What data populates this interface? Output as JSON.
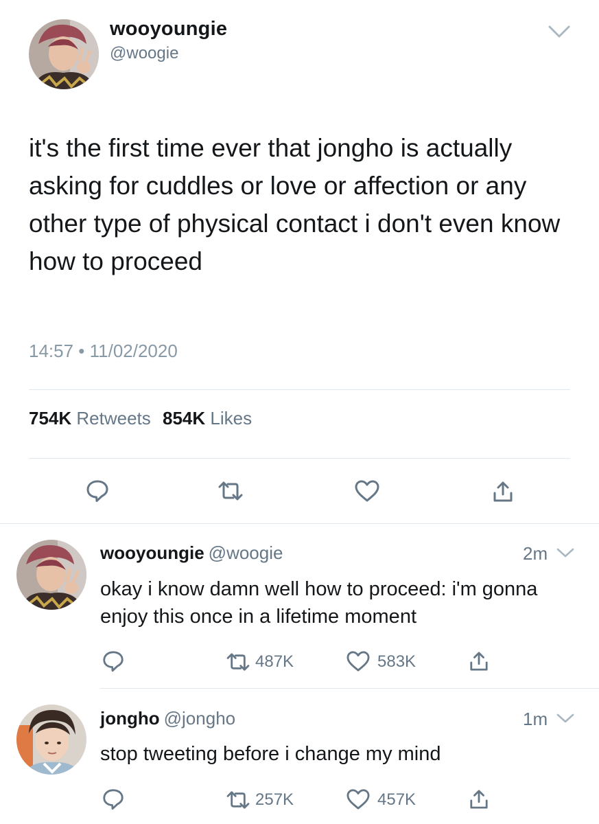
{
  "main_tweet": {
    "display_name": "wooyoungie",
    "handle": "@woogie",
    "text": "it's the first time ever that jongho is actually asking for cuddles or love or affection or any other type of physical contact i don't even know how to proceed",
    "timestamp": "14:57 • 11/02/2020",
    "retweets_count": "754K",
    "retweets_label": "Retweets",
    "likes_count": "854K",
    "likes_label": "Likes"
  },
  "replies": [
    {
      "display_name": "wooyoungie",
      "handle": "@woogie",
      "time": "2m",
      "text": "okay i know damn well how to proceed: i'm gonna enjoy this once in a lifetime moment",
      "retweets": "487K",
      "likes": "583K"
    },
    {
      "display_name": "jongho",
      "handle": "@jongho",
      "time": "1m",
      "text": "stop tweeting before i change my mind",
      "retweets": "257K",
      "likes": "457K"
    }
  ],
  "icons": {
    "reply": "reply-icon",
    "retweet": "retweet-icon",
    "like": "heart-icon",
    "share": "share-icon",
    "more": "chevron-down-icon"
  },
  "colors": {
    "text": "#14171a",
    "secondary": "#657786",
    "timestamp": "#8899a6",
    "divider": "#e1e8ed"
  }
}
